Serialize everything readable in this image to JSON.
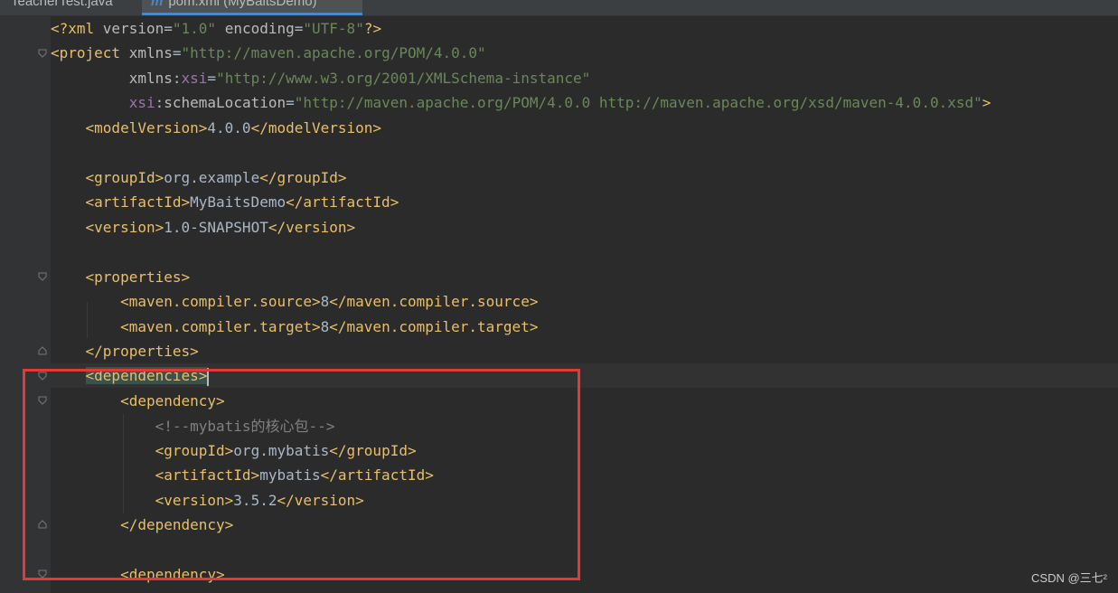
{
  "tabs": [
    {
      "label": "TeacherTest.java"
    },
    {
      "label": "pom.xml (MyBaitsDemo)",
      "icon": "m"
    }
  ],
  "code": {
    "xml_decl": {
      "version_val": "\"1.0\"",
      "encoding_val": "\"UTF-8\""
    },
    "project_ns": "\"http://maven.apache.org/POM/4.0.0\"",
    "xsi_ns": "\"http://www.w3.org/2001/XMLSchema-instance\"",
    "schema_location": "\"http://maven.apache.org/POM/4.0.0 http://maven.apache.org/xsd/maven-4.0.0.xsd\"",
    "model_version": "4.0.0",
    "group_id": "org.example",
    "artifact_id": "MyBaitsDemo",
    "version": "1.0-SNAPSHOT",
    "compiler_source": "8",
    "compiler_target": "8",
    "comment": "<!--mybatis的核心包-->",
    "dep_group_id": "org.mybatis",
    "dep_artifact_id": "mybatis",
    "dep_version": "3.5.2"
  },
  "watermark": "CSDN @三七²",
  "colors": {
    "tag": "#e8bf6a",
    "value": "#6a8759",
    "comment": "#808080",
    "annotation": "#e03b3b"
  }
}
